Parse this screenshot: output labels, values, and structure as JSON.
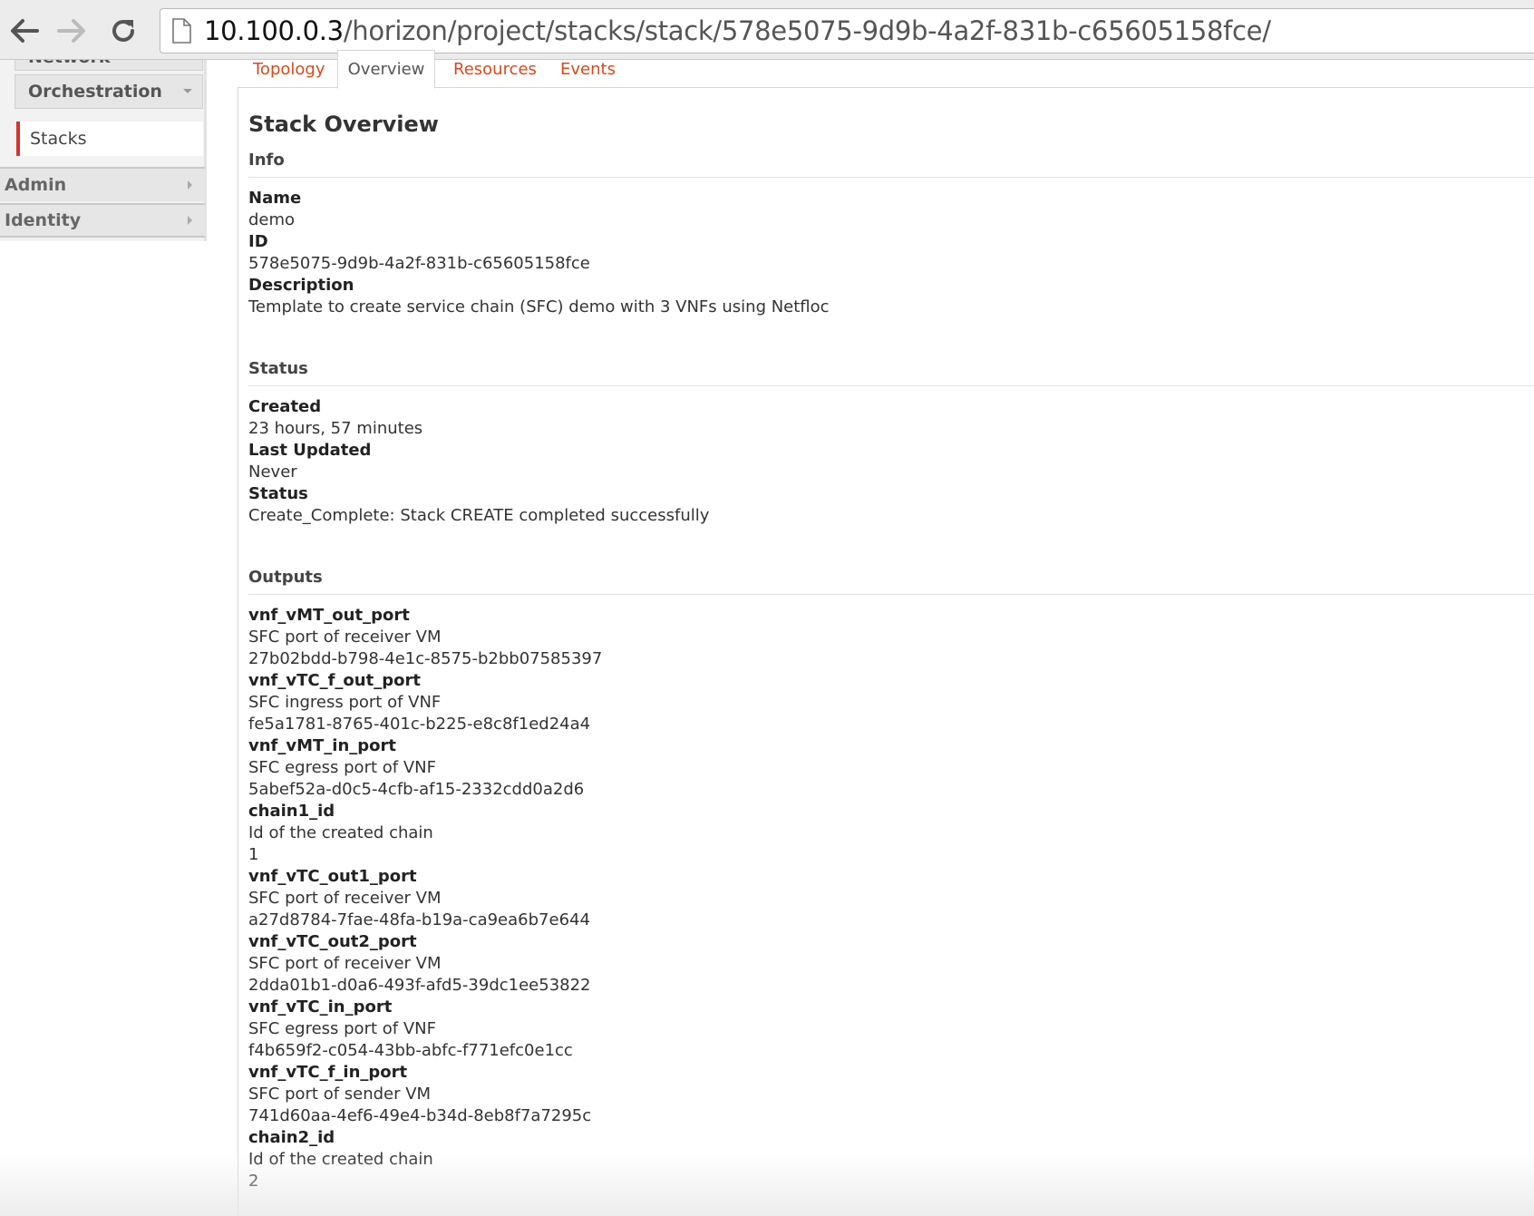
{
  "browser": {
    "url_host": "10.100.0.3",
    "url_path": "/horizon/project/stacks/stack/578e5075-9d9b-4a2f-831b-c65605158fce/",
    "back_icon": "arrow-left-icon",
    "forward_icon": "arrow-right-icon",
    "reload_icon": "reload-icon",
    "page_icon": "document-icon"
  },
  "sidebar": {
    "network_label": "Network",
    "orchestration_label": "Orchestration",
    "stacks_label": "Stacks",
    "admin_label": "Admin",
    "identity_label": "Identity",
    "active_color": "#d9332b"
  },
  "tabs": {
    "topology": "Topology",
    "overview": "Overview",
    "resources": "Resources",
    "events": "Events",
    "active": "Overview",
    "link_color": "#d24b1f"
  },
  "page": {
    "title": "Stack Overview"
  },
  "info": {
    "heading": "Info",
    "name_label": "Name",
    "name_value": "demo",
    "id_label": "ID",
    "id_value": "578e5075-9d9b-4a2f-831b-c65605158fce",
    "description_label": "Description",
    "description_value": "Template to create service chain (SFC) demo with 3 VNFs using Netfloc"
  },
  "status": {
    "heading": "Status",
    "created_label": "Created",
    "created_value": "23 hours, 57 minutes",
    "updated_label": "Last Updated",
    "updated_value": "Never",
    "status_label": "Status",
    "status_value": "Create_Complete: Stack CREATE completed successfully"
  },
  "outputs": {
    "heading": "Outputs",
    "items": [
      {
        "key": "vnf_vMT_out_port",
        "description": "SFC port of receiver VM",
        "value": "27b02bdd-b798-4e1c-8575-b2bb07585397"
      },
      {
        "key": "vnf_vTC_f_out_port",
        "description": "SFC ingress port of VNF",
        "value": "fe5a1781-8765-401c-b225-e8c8f1ed24a4"
      },
      {
        "key": "vnf_vMT_in_port",
        "description": "SFC egress port of VNF",
        "value": "5abef52a-d0c5-4cfb-af15-2332cdd0a2d6"
      },
      {
        "key": "chain1_id",
        "description": "Id of the created chain",
        "value": "1"
      },
      {
        "key": "vnf_vTC_out1_port",
        "description": "SFC port of receiver VM",
        "value": "a27d8784-7fae-48fa-b19a-ca9ea6b7e644"
      },
      {
        "key": "vnf_vTC_out2_port",
        "description": "SFC port of receiver VM",
        "value": "2dda01b1-d0a6-493f-afd5-39dc1ee53822"
      },
      {
        "key": "vnf_vTC_in_port",
        "description": "SFC egress port of VNF",
        "value": "f4b659f2-c054-43bb-abfc-f771efc0e1cc"
      },
      {
        "key": "vnf_vTC_f_in_port",
        "description": "SFC port of sender VM",
        "value": "741d60aa-4ef6-49e4-b34d-8eb8f7a7295c"
      },
      {
        "key": "chain2_id",
        "description": "Id of the created chain",
        "value": "2"
      }
    ]
  }
}
